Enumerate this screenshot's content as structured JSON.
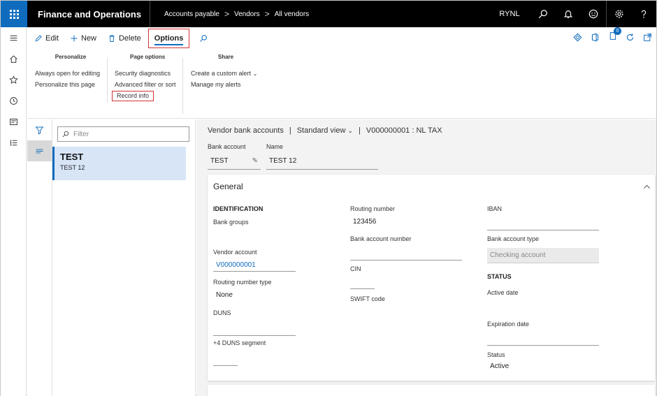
{
  "topbar": {
    "app_title": "Finance and Operations",
    "breadcrumbs": [
      "Accounts payable",
      "Vendors",
      "All vendors"
    ],
    "company": "RYNL",
    "icons": [
      "search-icon",
      "bell-icon",
      "smiley-icon",
      "gear-icon",
      "help-icon"
    ]
  },
  "leftnav": {
    "icons": [
      "hamburger-icon",
      "home-icon",
      "star-icon",
      "clock-icon",
      "workspace-icon",
      "list-icon"
    ]
  },
  "actionbar": {
    "edit": "Edit",
    "new": "New",
    "delete": "Delete",
    "options": "Options",
    "notification_count": "0"
  },
  "groups": {
    "personalize": {
      "title": "Personalize",
      "items": [
        "Always open for editing",
        "Personalize this page"
      ]
    },
    "page_options": {
      "title": "Page options",
      "items": [
        "Security diagnostics",
        "Advanced filter or sort",
        "Record info"
      ]
    },
    "share": {
      "title": "Share",
      "items": [
        "Create a custom alert",
        "Manage my alerts"
      ]
    }
  },
  "listpane": {
    "filter_placeholder": "Filter",
    "record": {
      "title": "TEST",
      "subtitle": "TEST 12"
    }
  },
  "details": {
    "header": {
      "form": "Vendor bank accounts",
      "sep": "|",
      "view": "Standard view",
      "sep2": "|",
      "record": "V000000001 : NL TAX"
    },
    "bank_account": {
      "label": "Bank account",
      "value": "TEST"
    },
    "name": {
      "label": "Name",
      "value": "TEST 12"
    },
    "general": {
      "title": "General",
      "col1": {
        "header": "IDENTIFICATION",
        "bank_groups": "Bank groups",
        "vendor_account_label": "Vendor account",
        "vendor_account_value": "V000000001",
        "routing_type_label": "Routing number type",
        "routing_type_value": "None",
        "duns_label": "DUNS",
        "duns4_label": "+4 DUNS segment"
      },
      "col2": {
        "routing_label": "Routing number",
        "routing_value": "123456",
        "bank_account_number_label": "Bank account number",
        "cin_label": "CIN",
        "swift_label": "SWIFT code"
      },
      "col3": {
        "iban_label": "IBAN",
        "bank_account_type_label": "Bank account type",
        "bank_account_type_value": "Checking account",
        "status_header": "STATUS",
        "active_date_label": "Active date",
        "expiration_date_label": "Expiration date",
        "status_label": "Status",
        "status_value": "Active"
      }
    }
  },
  "colors": {
    "accent": "#0f6cbd",
    "highlight_box": "#d13438",
    "selected_row": "#d7e5f7"
  }
}
